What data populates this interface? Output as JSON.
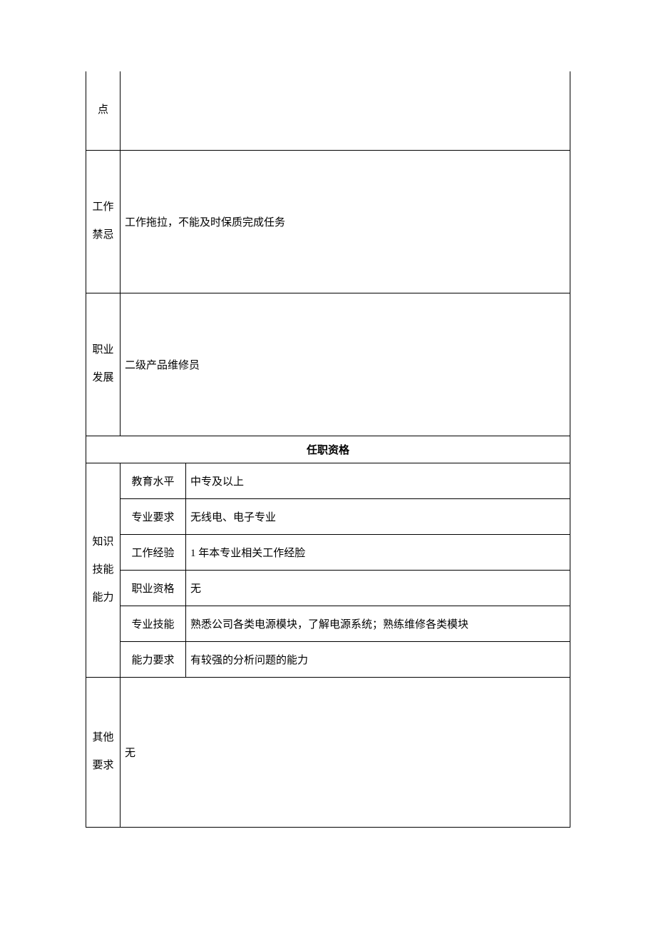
{
  "rows": {
    "point_label": "点",
    "taboo": {
      "label": "工作禁忌",
      "content": "工作拖拉，不能及时保质完成任务"
    },
    "career": {
      "label": "职业发展",
      "content": "二级产品维修员"
    },
    "section_header": "任职资格",
    "knowledge": {
      "label": "知识技能能力",
      "items": [
        {
          "sublabel": "教育水平",
          "content": "中专及以上"
        },
        {
          "sublabel": "专业要求",
          "content": "无线电、电子专业"
        },
        {
          "sublabel": "工作经验",
          "content": "1 年本专业相关工作经脸"
        },
        {
          "sublabel": "职业资格",
          "content": "无"
        },
        {
          "sublabel": "专业技能",
          "content": "熟悉公司各类电源模块，了解电源系统；熟练维修各类模块"
        },
        {
          "sublabel": "能力要求",
          "content": "有较强的分析问题的能力"
        }
      ]
    },
    "other": {
      "label": "其他要求",
      "content": "无"
    }
  }
}
